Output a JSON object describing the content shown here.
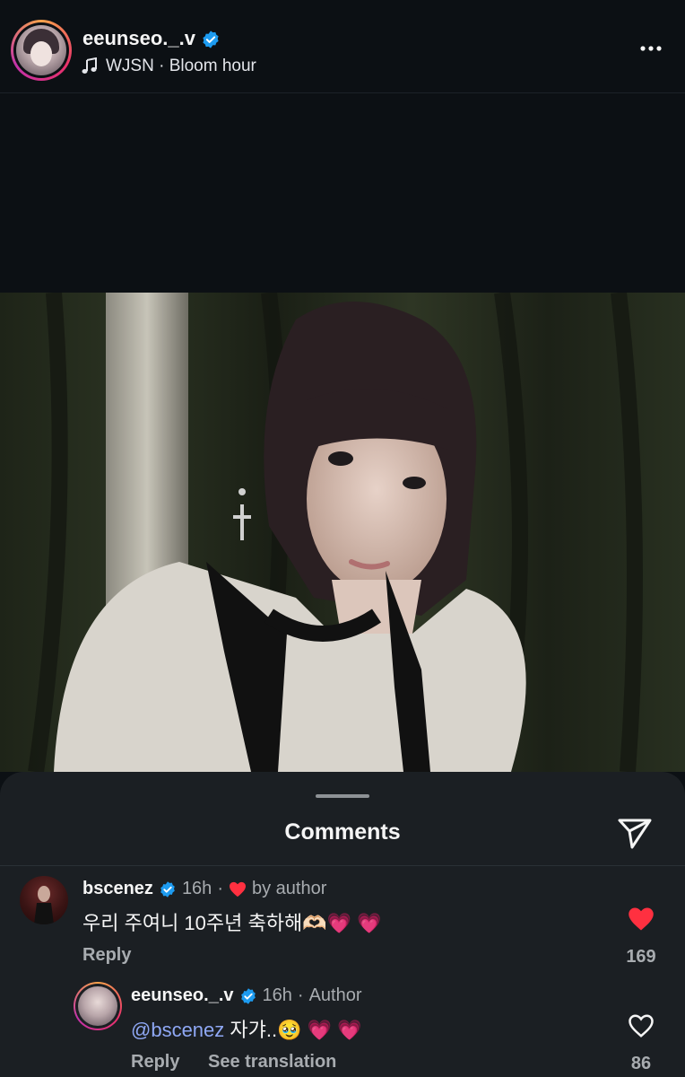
{
  "header": {
    "username": "eeunseo._.v",
    "music": "WJSN · Bloom hour"
  },
  "sheet": {
    "title": "Comments"
  },
  "comments": [
    {
      "username": "bscenez",
      "time": "16h",
      "sep": "·",
      "badge": "by author",
      "text": "우리 주여니 10주년 축하해🫶🏻💗 💗",
      "reply_label": "Reply",
      "likes": "169",
      "liked": true
    }
  ],
  "replies": [
    {
      "username": "eeunseo._.v",
      "time": "16h",
      "sep": "·",
      "badge": "Author",
      "mention": "@bscenez",
      "text": " 자갸..🥹 💗 💗",
      "reply_label": "Reply",
      "translate_label": "See translation",
      "likes": "86",
      "liked": false
    }
  ],
  "colors": {
    "background": "#0c1014",
    "sheet": "#1b1f23",
    "verified": "#1d9bf0",
    "like": "#ff3040",
    "mention": "#8fa8f5"
  }
}
